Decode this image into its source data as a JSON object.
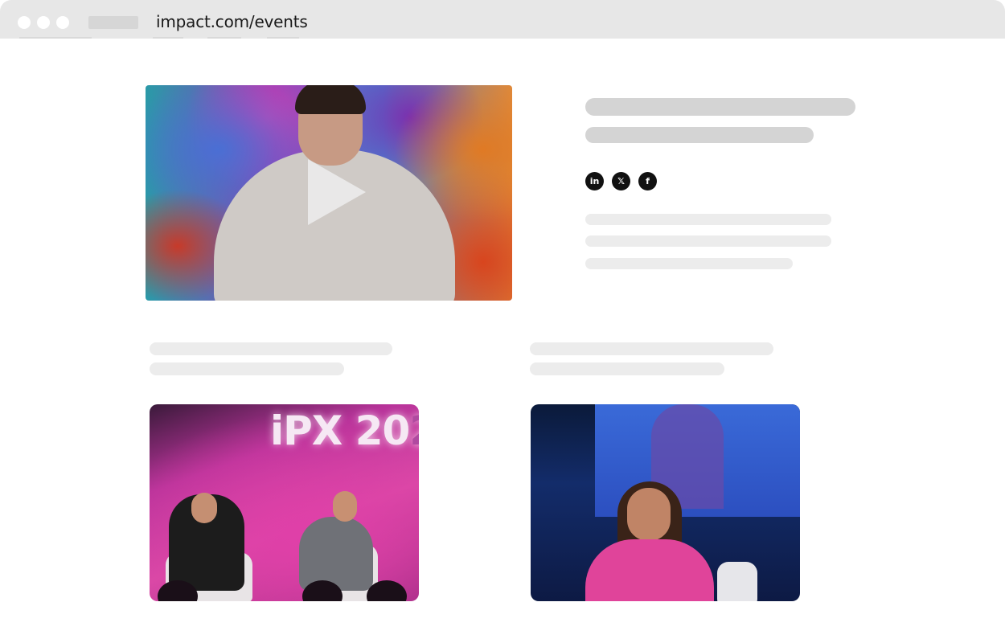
{
  "browser": {
    "url": "impact.com/events"
  },
  "hero": {
    "video": "play-icon"
  },
  "social": {
    "linkedin": "in",
    "x": "𝕏",
    "facebook": "f"
  },
  "gallery": {
    "photo1_sign": "iPX 20",
    "photo1_sign_partial": "2"
  },
  "colors": {
    "chrome": "#e7e7e7",
    "skeleton_dark": "#d4d4d4",
    "skeleton_light": "#ececec",
    "social_bg": "#111111"
  }
}
